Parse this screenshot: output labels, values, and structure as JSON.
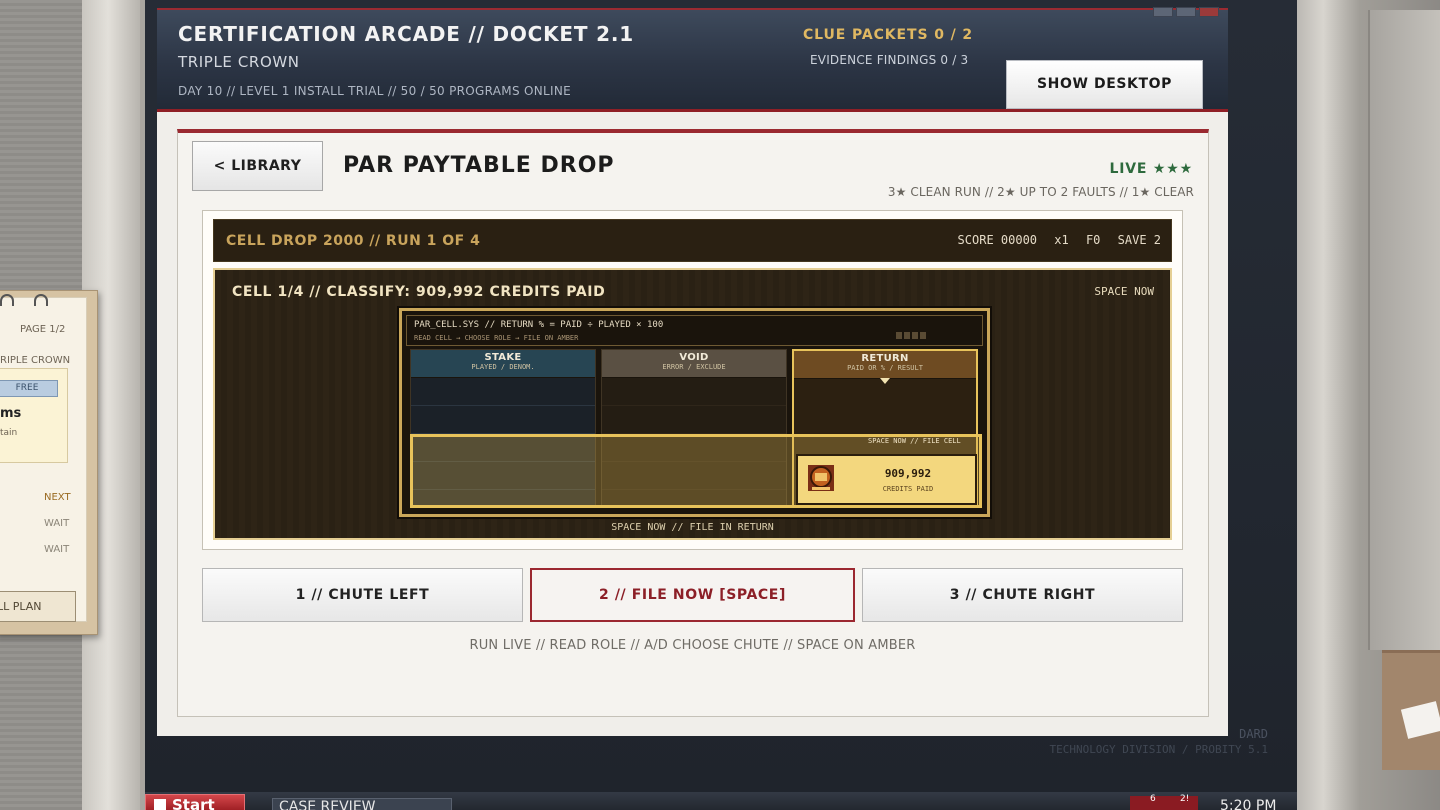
{
  "app": {
    "title": "CERTIFICATION ARCADE // DOCKET 2.1",
    "subtitle": "TRIPLE CROWN",
    "status_line": "DAY 10 // LEVEL 1 INSTALL TRIAL // 50 / 50 PROGRAMS ONLINE",
    "clue_packets": "CLUE PACKETS 0 / 2",
    "evidence_findings": "EVIDENCE FINDINGS 0 / 3",
    "show_desktop_label": "SHOW DESKTOP"
  },
  "game": {
    "library_label": "< LIBRARY",
    "title": "PAR PAYTABLE DROP",
    "live_label": "LIVE ★★★",
    "rating_legend": "3★ CLEAN RUN  //  2★ UP TO 2 FAULTS  //  1★ CLEAR",
    "hud": {
      "run_label": "CELL DROP 2000 // RUN 1 OF 4",
      "score": "SCORE 00000",
      "multiplier": "x1",
      "faults": "F0",
      "saves": "SAVE 2"
    },
    "playfield": {
      "cell_prompt": "CELL 1/4 // CLASSIFY: 909,992 CREDITS PAID",
      "space_prompt": "SPACE NOW",
      "bottom_prompt": "SPACE NOW // FILE IN RETURN",
      "terminal_header": "PAR_CELL.SYS // RETURN % = PAID ÷ PLAYED × 100",
      "terminal_sub": "READ CELL → CHOOSE ROLE → FILE ON AMBER",
      "columns": [
        {
          "name": "STAKE",
          "desc": "PLAYED / DENOM."
        },
        {
          "name": "VOID",
          "desc": "ERROR / EXCLUDE"
        },
        {
          "name": "RETURN",
          "desc": "PAID OR % / RESULT"
        }
      ],
      "file_cell_label": "SPACE NOW // FILE CELL",
      "cartridge_value": "909,992",
      "cartridge_unit": "CREDITS PAID"
    },
    "actions": [
      {
        "label": "1 // CHUTE LEFT"
      },
      {
        "label": "2 // FILE NOW  [SPACE]"
      },
      {
        "label": "3 // CHUTE RIGHT"
      }
    ],
    "hint": "RUN LIVE // READ ROLE // A/D CHOOSE CHUTE // SPACE ON AMBER"
  },
  "clipboard": {
    "page": "PAGE 1/2",
    "heading": "RIPLE CROWN",
    "badge": "FREE",
    "item_title": "ms",
    "item_sub": "tain",
    "rows": [
      "NEXT",
      "WAIT",
      "WAIT"
    ],
    "plan_button": "LL PLAN"
  },
  "footer": {
    "brand_line1": "DARD",
    "brand_line2": "TECHNOLOGY DIVISION  /  PROBITY 5.1"
  },
  "taskbar": {
    "start_label": "Start",
    "task_item": "CASE REVIEW",
    "badge_1": "6",
    "badge_2": "2!",
    "clock": "5:20 PM"
  },
  "colors": {
    "accent_red": "#9b2830",
    "amber": "#e8c35b",
    "live_green": "#2e6a3d",
    "clue_gold": "#e0b862"
  }
}
